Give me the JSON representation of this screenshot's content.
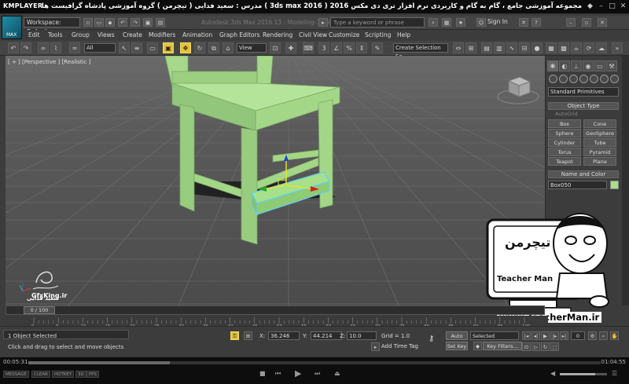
{
  "player": {
    "logo": "KMPLAYER",
    "title": "مجموعه آموزشی جامع ، گام به گام و کاربردی نرم افزار تری دی مکس 2016 ( 3ds max 2016 )  مدرس : سعید فدایی ( تیچرمن ) گروه آموزشی پادشاه گرافیست ها",
    "time_current": "00:05:31",
    "time_total": "01:04:55",
    "chips": [
      "MESSAGE",
      "CLEAR",
      "HOTKEY",
      "3D",
      "FPS"
    ]
  },
  "app": {
    "logo_label": "MAX",
    "workspace": "Workspace: Default",
    "doc_title": "Autodesk 3ds Max 2016   13 - Modeling-3.max",
    "search_placeholder": "Type a keyword or phrase",
    "signin": "Sign In",
    "menu": [
      "Edit",
      "Tools",
      "Group",
      "Views",
      "Create",
      "Modifiers",
      "Animation",
      "Graph Editors",
      "Rendering",
      "Civil View",
      "Customize",
      "Scripting",
      "Help"
    ],
    "toolbar": {
      "filter": "All",
      "refcoord": "View",
      "selection_set": "Create Selection Se"
    }
  },
  "viewport": {
    "label": "[ + ] [Perspective ] [Realistic ]"
  },
  "command_panel": {
    "dropdown": "Standard Primitives",
    "object_type_header": "Object Type",
    "autogrid": "AutoGrid",
    "object_buttons": [
      "Box",
      "Cone",
      "Sphere",
      "GeoSphere",
      "Cylinder",
      "Tube",
      "Torus",
      "Pyramid",
      "Teapot",
      "Plane"
    ],
    "name_color_header": "Name and Color",
    "object_name": "Box050",
    "object_color": "#a6e08a"
  },
  "watermarks": {
    "teacher_title": "تیچرمن",
    "teacher_en": "Teacher Man",
    "teacher_url": "www.TeacherMan.ir",
    "gfx": "GfxKing.ir",
    "fadaei": "سعید فدایی"
  },
  "timeline": {
    "thumb": "0 / 100",
    "ticks": [
      "0",
      "5",
      "10",
      "15",
      "20",
      "25",
      "30",
      "35",
      "40",
      "45",
      "50",
      "55",
      "60",
      "65",
      "70",
      "75",
      "80",
      "85",
      "90",
      "95",
      "100"
    ]
  },
  "status": {
    "selection": "1 Object Selected",
    "prompt": "Click and drag to select and move objects",
    "x_label": "X:",
    "x": "36.246",
    "y_label": "Y:",
    "y": "44.214",
    "z_label": "Z:",
    "z": "10.0",
    "grid": "Grid = 1.0",
    "add_time_tag": "Add Time Tag",
    "auto_key": "Auto Key",
    "set_key": "Set Key",
    "selected": "Selected",
    "key_filters": "Key Filters...",
    "frame": "0"
  }
}
